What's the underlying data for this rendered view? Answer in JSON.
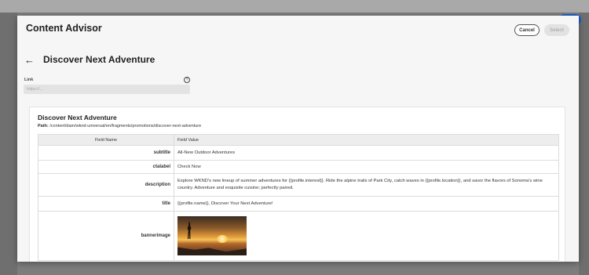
{
  "modal": {
    "title": "Content Advisor",
    "cancel_label": "Cancel",
    "select_label": "Select"
  },
  "page": {
    "back_icon": "arrow-left-icon",
    "title": "Discover Next Adventure"
  },
  "link": {
    "label": "Link",
    "help_icon": "help-icon",
    "help_glyph": "?",
    "placeholder": "https://..."
  },
  "fragment": {
    "title": "Discover Next Adventure",
    "path_label": "Path:",
    "path": "/content/dam/wknd-universal/en/fragments/promotions/discover-next-adventure",
    "columns": [
      "Field Name",
      "Field Value"
    ],
    "rows": [
      {
        "name": "subtitle",
        "value": "All-New Outdoor Adventures"
      },
      {
        "name": "ctalabel",
        "value": "Check Now"
      },
      {
        "name": "description",
        "value": "Explore WKND's new lineup of summer adventures for {{profile.interest}}. Ride the alpine trails of Park City, catch waves in {{profile.location}}, and savor the flavors of Sonoma's wine country. Adventure and exquisite cuisine; perfectly paired."
      },
      {
        "name": "title",
        "value": "{{profile.name}}, Discover Your Next Adventure!"
      },
      {
        "name": "bannerimage",
        "value": "hiker-sunset-image"
      }
    ]
  }
}
